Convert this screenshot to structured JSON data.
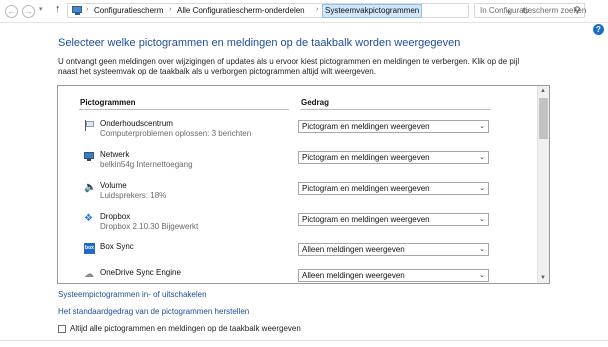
{
  "address_bar": {
    "breadcrumbs": [
      "Configuratiescherm",
      "Alle Configuratiescherm-onderdelen",
      "Systeemvakpictogrammen"
    ],
    "separator": "›",
    "search_placeholder": "In Configuratiescherm zoeken"
  },
  "page": {
    "title": "Selecteer welke pictogrammen en meldingen op de taakbalk worden weergegeven",
    "description": "U ontvangt geen meldingen over wijzigingen of updates als u ervoor kiest pictogrammen en meldingen te verbergen. Klik op de pijl naast het systeemvak op de taakbalk als u verborgen pictogrammen altijd wilt weergeven."
  },
  "table": {
    "col_icons": "Pictogrammen",
    "col_behavior": "Gedrag",
    "rows": [
      {
        "name": "Onderhoudscentrum",
        "sub": "Computerproblemen oplossen: 3 berichten",
        "behavior": "Pictogram en meldingen weergeven",
        "icon": "flag-icon"
      },
      {
        "name": "Netwerk",
        "sub": "belkin54g Internettoegang",
        "behavior": "Pictogram en meldingen weergeven",
        "icon": "network-icon"
      },
      {
        "name": "Volume",
        "sub": "Luidsprekers: 18%",
        "behavior": "Pictogram en meldingen weergeven",
        "icon": "speaker-icon"
      },
      {
        "name": "Dropbox",
        "sub": "Dropbox 2.10.30 Bijgewerkt",
        "behavior": "Pictogram en meldingen weergeven",
        "icon": "dropbox-icon"
      },
      {
        "name": "Box Sync",
        "sub": "",
        "behavior": "Alleen meldingen weergeven",
        "icon": "box-sync-icon"
      },
      {
        "name": "OneDrive Sync Engine",
        "sub": "",
        "behavior": "Alleen meldingen weergeven",
        "icon": "cloud-icon"
      }
    ]
  },
  "links": {
    "system_icons": "Systeempictogrammen in- of uitschakelen",
    "restore_default": "Het standaardgedrag van de pictogrammen herstellen"
  },
  "checkbox": {
    "label": "Altijd alle pictogrammen en meldingen op de taakbalk weergeven",
    "checked": false
  },
  "colors": {
    "title_blue": "#1f4e9a",
    "link_blue": "#1f4e9a",
    "breadcrumb_highlight": "#cfe6fb"
  }
}
